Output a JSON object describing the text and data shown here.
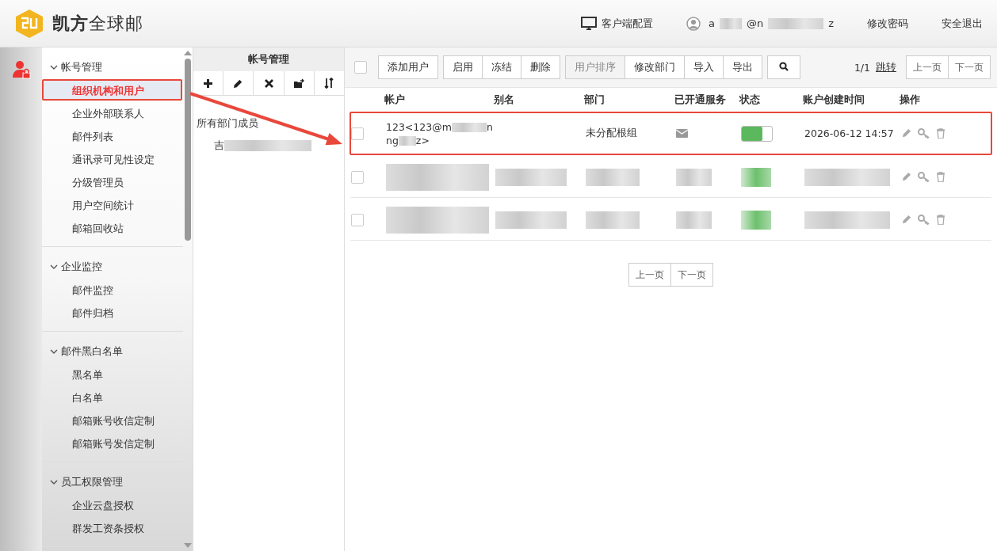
{
  "header": {
    "brand": "**凯方**全球邮",
    "client_config": "客户端配置",
    "user_email_parts": [
      "a",
      "@n",
      "z"
    ],
    "change_password": "修改密码",
    "logout": "安全退出"
  },
  "sidebar": {
    "groups": [
      {
        "title": "帐号管理",
        "expanded": true,
        "items": [
          {
            "label": "组织机构和用户",
            "selected": true,
            "highlighted": true
          },
          {
            "label": "企业外部联系人",
            "selected": false,
            "highlighted": false
          },
          {
            "label": "邮件列表",
            "selected": false,
            "highlighted": false
          },
          {
            "label": "通讯录可见性设定",
            "selected": false,
            "highlighted": false
          },
          {
            "label": "分级管理员",
            "selected": false,
            "highlighted": false
          },
          {
            "label": "用户空间统计",
            "selected": false,
            "highlighted": false
          },
          {
            "label": "邮箱回收站",
            "selected": false,
            "highlighted": false
          }
        ]
      },
      {
        "title": "企业监控",
        "expanded": true,
        "items": [
          {
            "label": "邮件监控",
            "selected": false,
            "highlighted": false
          },
          {
            "label": "邮件归档",
            "selected": false,
            "highlighted": false
          }
        ]
      },
      {
        "title": "邮件黑白名单",
        "expanded": true,
        "items": [
          {
            "label": "黑名单",
            "selected": false,
            "highlighted": false
          },
          {
            "label": "白名单",
            "selected": false,
            "highlighted": false
          },
          {
            "label": "邮箱账号收信定制",
            "selected": false,
            "highlighted": false
          },
          {
            "label": "邮箱账号发信定制",
            "selected": false,
            "highlighted": false
          }
        ]
      },
      {
        "title": "员工权限管理",
        "expanded": true,
        "items": [
          {
            "label": "企业云盘授权",
            "selected": false,
            "highlighted": false
          },
          {
            "label": "群发工资条授权",
            "selected": false,
            "highlighted": false
          }
        ]
      }
    ]
  },
  "dept_panel": {
    "title": "帐号管理",
    "tree": {
      "label": "所有部门成员",
      "children": [
        {
          "label": "吉",
          "redacted": true
        }
      ]
    }
  },
  "toolbar": {
    "select_all_checked": false,
    "button_groups": [
      [
        {
          "label": "添加用户",
          "disabled": false
        }
      ],
      [
        {
          "label": "启用",
          "disabled": false
        },
        {
          "label": "冻结",
          "disabled": false
        },
        {
          "label": "删除",
          "disabled": false
        }
      ],
      [
        {
          "label": "用户排序",
          "disabled": true
        },
        {
          "label": "修改部门",
          "disabled": false
        },
        {
          "label": "导入",
          "disabled": false
        },
        {
          "label": "导出",
          "disabled": false
        }
      ]
    ],
    "page_info": "1/1",
    "jump": "跳转",
    "prev": "上一页",
    "next": "下一页"
  },
  "table": {
    "columns": [
      "帐户",
      "别名",
      "部门",
      "已开通服务",
      "状态",
      "账户创建时间",
      "操作"
    ],
    "rows": [
      {
        "kind": "visible",
        "checked": false,
        "highlighted": true,
        "account_lines": [
          [
            "123<123@m",
            "n"
          ],
          [
            "ng",
            "z>"
          ]
        ],
        "department": "未分配根组",
        "status_on": true,
        "created": "2026-06-12 14:57"
      },
      {
        "kind": "redacted",
        "checked": false,
        "highlighted": false
      },
      {
        "kind": "redacted",
        "checked": false,
        "highlighted": false
      }
    ]
  },
  "pager": {
    "prev": "上一页",
    "next": "下一页"
  }
}
